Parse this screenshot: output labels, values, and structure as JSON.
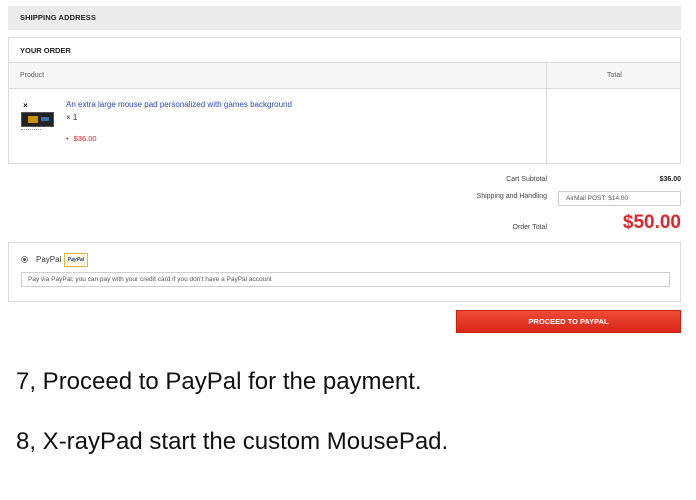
{
  "sections": {
    "shipping_address": "SHIPPING ADDRESS",
    "your_order": "YOUR ORDER"
  },
  "table": {
    "col_product": "Product",
    "col_total": "Total"
  },
  "item": {
    "remove_glyph": "×",
    "name": "An extra large mouse pad personalized with games background",
    "qty": "× 1",
    "bullet": "•",
    "price": "$36.00"
  },
  "summary": {
    "subtotal_label": "Cart Subtotal",
    "subtotal_value": "$36.00",
    "shipping_label": "Shipping and Handling",
    "shipping_value": "AirMail POST: $14.00",
    "total_label": "Order Total",
    "total_value": "$50.00"
  },
  "payment": {
    "method_label": "PayPal",
    "badge": "PayPal",
    "description": "Pay via PayPal; you can pay with your credit card if you don't have a PayPal account",
    "selected": true
  },
  "actions": {
    "proceed_label": "PROCEED TO PAYPAL"
  },
  "steps": [
    "7, Proceed to PayPal for the payment.",
    "8, X-rayPad start the custom MousePad."
  ],
  "colors": {
    "accent_red": "#e0262c",
    "link_blue": "#2b4cc4"
  }
}
